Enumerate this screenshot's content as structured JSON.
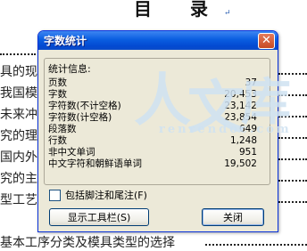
{
  "document": {
    "title": "目 录",
    "paragraph_mark": "↵",
    "lines": [
      "具的现",
      "我国模具",
      "未来冲压",
      "究的理",
      "国内外",
      "究的主",
      "型工艺",
      "基本工序分类及模具类型的选择"
    ]
  },
  "watermark": {
    "chars": [
      "人",
      "文",
      "库"
    ],
    "url": "renrendoc.com"
  },
  "dialog": {
    "title": "字数统计",
    "close_glyph": "✕",
    "group_label": "统计信息:",
    "stats": [
      {
        "label": "页数",
        "value": "37"
      },
      {
        "label": "字数",
        "value": "20,453"
      },
      {
        "label": "字符数(不计空格)",
        "value": "23,142"
      },
      {
        "label": "字符数(计空格)",
        "value": "23,854"
      },
      {
        "label": "段落数",
        "value": "649"
      },
      {
        "label": "行数",
        "value": "1,248"
      },
      {
        "label": "非中文单词",
        "value": "951"
      },
      {
        "label": "中文字符和朝鲜语单词",
        "value": "19,502"
      }
    ],
    "checkbox_label": "包括脚注和尾注(F)",
    "checkbox_checked": false,
    "toolbar_button": "显示工具栏(S)",
    "close_button": "关闭"
  },
  "colors": {
    "titlebar": "#0a5ee0",
    "dialog_bg": "#ece9d8",
    "watermark": "#cfe2f2"
  }
}
